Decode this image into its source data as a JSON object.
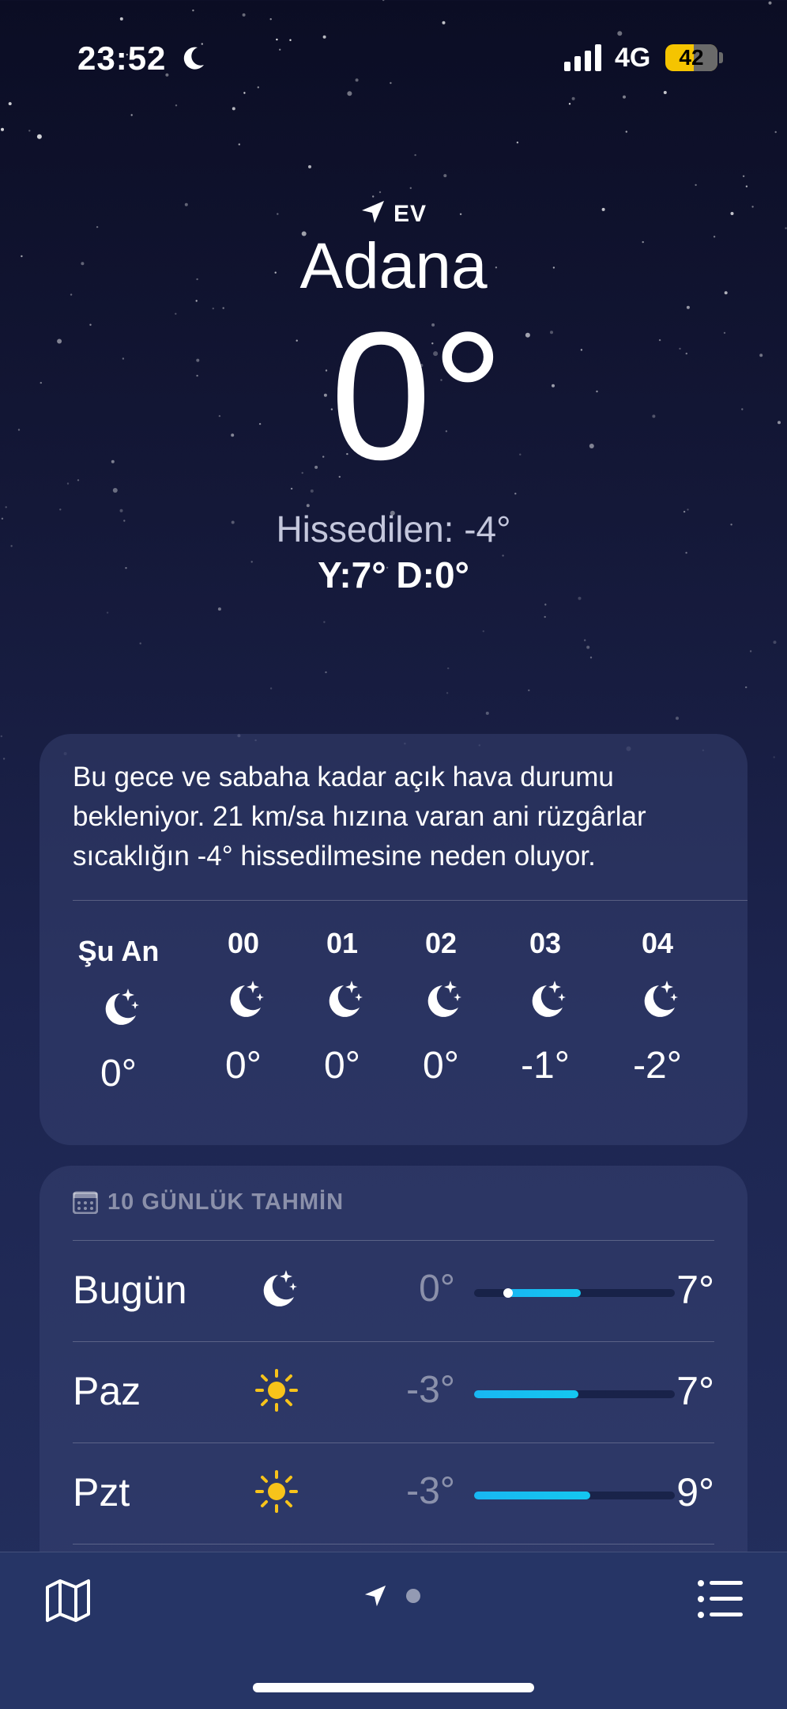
{
  "status_bar": {
    "time": "23:52",
    "network": "4G",
    "battery": "42"
  },
  "location": {
    "label": "EV",
    "city": "Adana",
    "temperature": "0°",
    "feels_like": "Hissedilen: -4°",
    "high_low": "Y:7° D:0°"
  },
  "hourly": {
    "summary": "Bu gece ve sabaha kadar açık hava durumu bekleniyor. 21 km/sa hızına varan ani rüzgârlar sıcaklığın -4° hissedilmesine neden oluyor.",
    "items": [
      {
        "label": "Şu An",
        "icon": "moon-stars-icon",
        "temp": "0°"
      },
      {
        "label": "00",
        "icon": "moon-stars-icon",
        "temp": "0°"
      },
      {
        "label": "01",
        "icon": "moon-stars-icon",
        "temp": "0°"
      },
      {
        "label": "02",
        "icon": "moon-stars-icon",
        "temp": "0°"
      },
      {
        "label": "03",
        "icon": "moon-stars-icon",
        "temp": "-1°"
      },
      {
        "label": "04",
        "icon": "moon-stars-icon",
        "temp": "-2°"
      }
    ]
  },
  "forecast": {
    "title": "10 GÜNLÜK TAHMİN",
    "days": [
      {
        "day": "Bugün",
        "icon": "moon-stars-icon",
        "low": "0°",
        "high": "7°",
        "range_start": 0.17,
        "range_end": 0.53,
        "current_marker": 0.17
      },
      {
        "day": "Paz",
        "icon": "sun-icon",
        "low": "-3°",
        "high": "7°",
        "range_start": 0.0,
        "range_end": 0.52
      },
      {
        "day": "Pzt",
        "icon": "sun-icon",
        "low": "-3°",
        "high": "9°",
        "range_start": 0.0,
        "range_end": 0.58
      }
    ]
  },
  "colors": {
    "range_fill": "#14c7f0",
    "sun": "#f7c31a",
    "battery": "#f5c400",
    "bottom_bar": "#263566"
  },
  "bottom_bar": {
    "left_icon": "map-icon",
    "center_icon": "location-arrow-icon",
    "right_icon": "list-icon"
  }
}
